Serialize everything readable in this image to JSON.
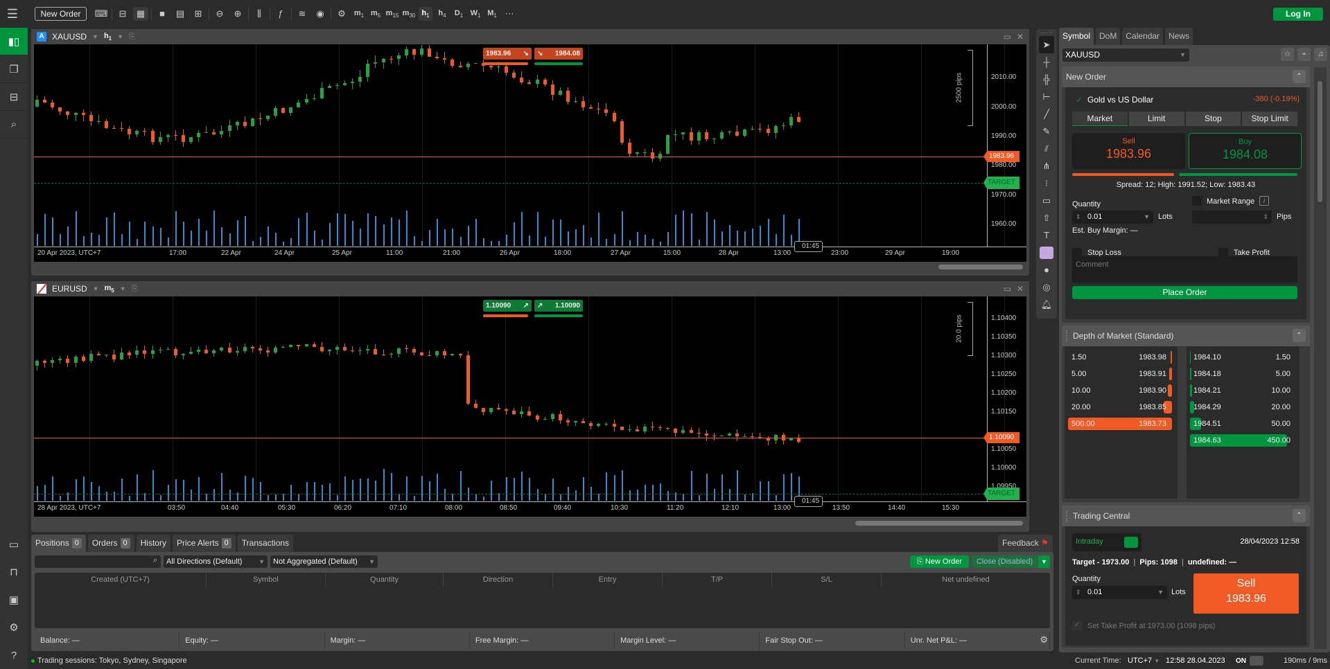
{
  "topbar": {
    "new_order_label": "New Order",
    "login_label": "Log In",
    "icons": [
      "chart-monitor-icon",
      "layout-icon",
      "grid-4-icon",
      "single-square-icon",
      "split-layout-icon",
      "add-chart-icon",
      "zoom-out-icon",
      "zoom-in-icon",
      "candlestick-type-icon",
      "indicator-f-icon",
      "layers-icon",
      "eye-icon",
      "chart-settings-icon"
    ],
    "timeframes": [
      {
        "main": "m",
        "sub": "1"
      },
      {
        "main": "m",
        "sub": "5"
      },
      {
        "main": "m",
        "sub": "15"
      },
      {
        "main": "m",
        "sub": "30"
      },
      {
        "main": "h",
        "sub": "1",
        "active": true
      },
      {
        "main": "h",
        "sub": "4"
      },
      {
        "main": "D",
        "sub": "1"
      },
      {
        "main": "W",
        "sub": "1"
      },
      {
        "main": "M",
        "sub": "1"
      }
    ],
    "more_label": "⋯"
  },
  "leftnav": {
    "items": [
      "trade-candles-icon",
      "copy-icon",
      "automate-robot-icon",
      "analyze-search-icon"
    ],
    "bottom": [
      "briefcase-icon",
      "deposit-icon",
      "wallet-icon",
      "settings-gear-icon",
      "help-icon"
    ]
  },
  "chart1": {
    "symbol": "XAUUSD",
    "badge": "A",
    "timeframe_main": "h",
    "timeframe_sub": "1",
    "sell_price": "1983.96",
    "buy_price": "1984.08",
    "measure_label": "2500 pips",
    "price_tag": "1983.96",
    "target_tag": "TARGET",
    "countdown": "01:45",
    "y_ticks": [
      "2010.00",
      "2000.00",
      "1990.00",
      "1980.00",
      "1970.00",
      "1960.00"
    ],
    "x_ticks": [
      "20 Apr 2023, UTC+7",
      "17:00",
      "22 Apr",
      "24 Apr",
      "25 Apr",
      "11:00",
      "21:00",
      "26 Apr",
      "18:00",
      "27 Apr",
      "15:00",
      "28 Apr",
      "13:00",
      "23:00",
      "29 Apr",
      "19:00"
    ]
  },
  "chart2": {
    "symbol": "EURUSD",
    "timeframe_main": "m",
    "timeframe_sub": "5",
    "sell_price": "1.10090",
    "buy_price": "1.10090",
    "measure_label": "20.0 pips",
    "price_tag": "1.10090",
    "target_tag": "TARGET",
    "countdown": "01:45",
    "y_ticks": [
      "1.10400",
      "1.10350",
      "1.10300",
      "1.10250",
      "1.10200",
      "1.10150",
      "1.10050",
      "1.10000",
      "1.09950"
    ],
    "x_ticks": [
      "28 Apr 2023, UTC+7",
      "03:50",
      "04:40",
      "05:30",
      "06:20",
      "07:10",
      "08:00",
      "08:50",
      "09:40",
      "10:30",
      "11:20",
      "12:10",
      "13:00",
      "13:50",
      "14:40",
      "15:30"
    ]
  },
  "drawtools": [
    "cursor-icon",
    "crosshair-icon",
    "crosshair-snap-icon",
    "measure-icon",
    "line-icon",
    "pencil-icon",
    "fibonacci-icon",
    "pitchfork-icon",
    "fib-grid-icon",
    "rectangle-icon",
    "arrow-up-icon",
    "text-icon",
    "color-swatch-icon",
    "opacity-icon",
    "camera-icon",
    "alert-bell-icon"
  ],
  "right": {
    "tabs": [
      "Symbol",
      "DoM",
      "Calendar",
      "News"
    ],
    "symbol_value": "XAUUSD",
    "new_order": {
      "title": "New Order",
      "symbol_name": "Gold vs US Dollar",
      "change": "-380 (-0.19%)",
      "order_types": [
        "Market",
        "Limit",
        "Stop",
        "Stop Limit"
      ],
      "sell_label": "Sell",
      "sell_price": "1983.96",
      "buy_label": "Buy",
      "buy_price": "1984.08",
      "spread_info": "Spread: 12; High: 1991.52; Low: 1983.43",
      "quantity_label": "Quantity",
      "quantity_value": "0.01",
      "lots_label": "Lots",
      "market_range_label": "Market Range",
      "pips_label": "Pips",
      "est_margin": "Est. Buy Margin: —",
      "stop_loss_label": "Stop Loss",
      "take_profit_label": "Take Profit",
      "comment_placeholder": "Comment",
      "place_order_label": "Place Order"
    },
    "dom": {
      "title": "Depth of Market (Standard)",
      "bids": [
        {
          "vol": "1.50",
          "price": "1983.98"
        },
        {
          "vol": "5.00",
          "price": "1983.91"
        },
        {
          "vol": "10.00",
          "price": "1983.90"
        },
        {
          "vol": "20.00",
          "price": "1983.85"
        },
        {
          "vol": "500.00",
          "price": "1983.73"
        }
      ],
      "asks": [
        {
          "price": "1984.10",
          "vol": "1.50"
        },
        {
          "price": "1984.18",
          "vol": "5.00"
        },
        {
          "price": "1984.21",
          "vol": "10.00"
        },
        {
          "price": "1984.29",
          "vol": "20.00"
        },
        {
          "price": "1984.51",
          "vol": "50.00"
        },
        {
          "price": "1984.63",
          "vol": "450.00"
        }
      ]
    },
    "trading_central": {
      "title": "Trading Central",
      "mode": "Intraday",
      "datetime": "28/04/2023 12:58",
      "target": "Target - 1973.00",
      "pips": "Pips: 1098",
      "undefined_label": "undefined: —",
      "quantity_label": "Quantity",
      "quantity_value": "0.01",
      "lots_label": "Lots",
      "sell_label": "Sell",
      "sell_price": "1983.96",
      "set_tp": "Set Take Profit at 1973.00 (1098 pips)"
    }
  },
  "bottom": {
    "tabs": [
      {
        "label": "Positions",
        "count": "0"
      },
      {
        "label": "Orders",
        "count": "0"
      },
      {
        "label": "History"
      },
      {
        "label": "Price Alerts",
        "count": "0"
      },
      {
        "label": "Transactions"
      }
    ],
    "feedback_label": "Feedback",
    "direction_filter": "All Directions (Default)",
    "aggregation_filter": "Not Aggregated (Default)",
    "new_order_label": "New Order",
    "close_label": "Close (Disabled)",
    "columns": [
      "Created (UTC+7)",
      "Symbol",
      "Quantity",
      "Direction",
      "Entry",
      "T/P",
      "S/L",
      "Net undefined"
    ],
    "account": [
      "Balance: —",
      "Equity: —",
      "Margin: —",
      "Free Margin: —",
      "Margin Level: —",
      "Fair Stop Out: —",
      "Unr. Net P&L: —"
    ]
  },
  "status": {
    "sessions": "Trading sessions: Tokyo, Sydney, Singapore",
    "current_time_label": "Current Time:",
    "timezone": "UTC+7",
    "time": "12:58 28.04.2023",
    "on_label": "ON",
    "latency": "190ms / 9ms"
  },
  "colors": {
    "accent": "#00963f",
    "sell": "#f05a24",
    "buy": "#00963f",
    "volume": "#2d8fd8"
  }
}
